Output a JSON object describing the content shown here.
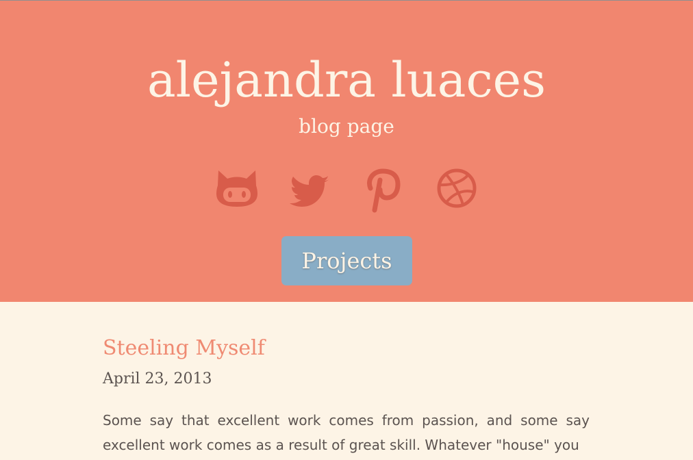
{
  "header": {
    "title": "alejandra luaces",
    "subtitle": "blog page",
    "social_links": [
      {
        "icon": "github-icon",
        "color": "#d85c4a"
      },
      {
        "icon": "twitter-icon",
        "color": "#d85c4a"
      },
      {
        "icon": "pinterest-icon",
        "color": "#d85c4a"
      },
      {
        "icon": "dribbble-icon",
        "color": "#d85c4a"
      }
    ],
    "projects_label": "Projects"
  },
  "post": {
    "title": "Steeling Myself",
    "date": "April 23, 2013",
    "excerpt": "Some say that excellent work comes from passion, and some say excellent work comes as a result of great skill. Whatever \"house\" you"
  },
  "colors": {
    "header_bg": "#f1866f",
    "page_bg": "#fdf4e6",
    "button_bg": "#89adc6",
    "post_title": "#ef8a72",
    "body_text": "#5b5350"
  }
}
